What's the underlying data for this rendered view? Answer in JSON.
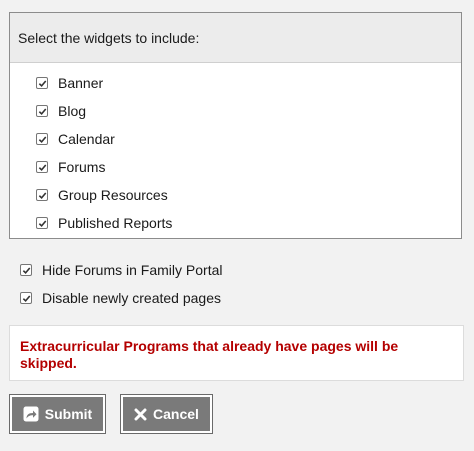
{
  "widgets": {
    "header": "Select the widgets to include:",
    "items": [
      {
        "label": "Banner",
        "checked": true
      },
      {
        "label": "Blog",
        "checked": true
      },
      {
        "label": "Calendar",
        "checked": true
      },
      {
        "label": "Forums",
        "checked": true
      },
      {
        "label": "Group Resources",
        "checked": true
      },
      {
        "label": "Published Reports",
        "checked": true
      }
    ]
  },
  "options": {
    "hide_forums": {
      "label": "Hide Forums in Family Portal",
      "checked": true
    },
    "disable_pages": {
      "label": "Disable newly created pages",
      "checked": true
    }
  },
  "warning": {
    "text": "Extracurricular Programs that already have pages will be skipped.",
    "color": "#b40000"
  },
  "buttons": {
    "submit_label": "Submit",
    "submit_icon": "share-arrow-icon",
    "cancel_label": "Cancel",
    "cancel_icon": "close-x-icon"
  }
}
